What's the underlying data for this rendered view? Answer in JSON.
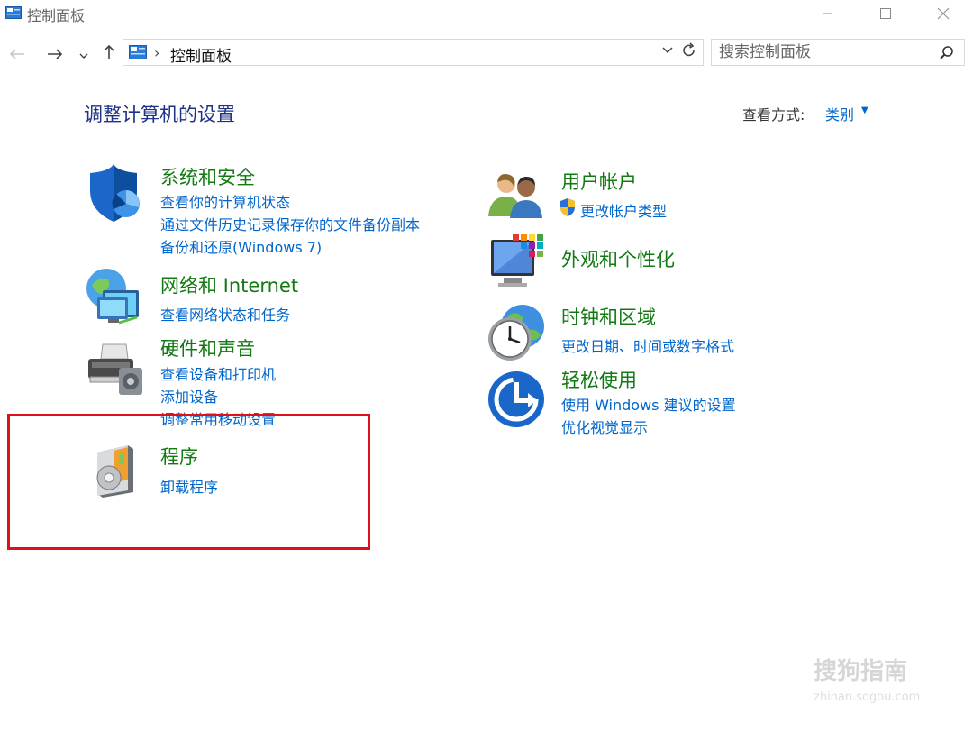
{
  "window": {
    "title": "控制面板"
  },
  "address": {
    "path": "控制面板",
    "separator": "›"
  },
  "search": {
    "placeholder": "搜索控制面板"
  },
  "header": {
    "title": "调整计算机的设置",
    "view_label": "查看方式:",
    "view_value": "类别"
  },
  "categories": [
    {
      "title": "系统和安全",
      "links": [
        "查看你的计算机状态",
        "通过文件历史记录保存你的文件备份副本",
        "备份和还原(Windows 7)"
      ],
      "icon": "shield-icon"
    },
    {
      "title": "网络和 Internet",
      "links": [
        "查看网络状态和任务"
      ],
      "icon": "network-icon"
    },
    {
      "title": "硬件和声音",
      "links": [
        "查看设备和打印机",
        "添加设备",
        "调整常用移动设置"
      ],
      "icon": "printer-icon"
    },
    {
      "title": "程序",
      "links": [
        "卸载程序"
      ],
      "icon": "programs-icon"
    },
    {
      "title": "用户帐户",
      "links": [
        "更改帐户类型"
      ],
      "icon": "users-icon"
    },
    {
      "title": "外观和个性化",
      "links": [],
      "icon": "appearance-icon"
    },
    {
      "title": "时钟和区域",
      "links": [
        "更改日期、时间或数字格式"
      ],
      "icon": "clock-icon"
    },
    {
      "title": "轻松使用",
      "links": [
        "使用 Windows 建议的设置",
        "优化视觉显示"
      ],
      "icon": "ease-of-access-icon"
    }
  ],
  "colors": {
    "title_blue": "#1e3287",
    "category_green": "#137a13",
    "link_blue": "#0066cc",
    "highlight_red": "#e0101a"
  },
  "watermark": {
    "text": "搜狗指南",
    "sub": "zhinan.sogou.com"
  }
}
